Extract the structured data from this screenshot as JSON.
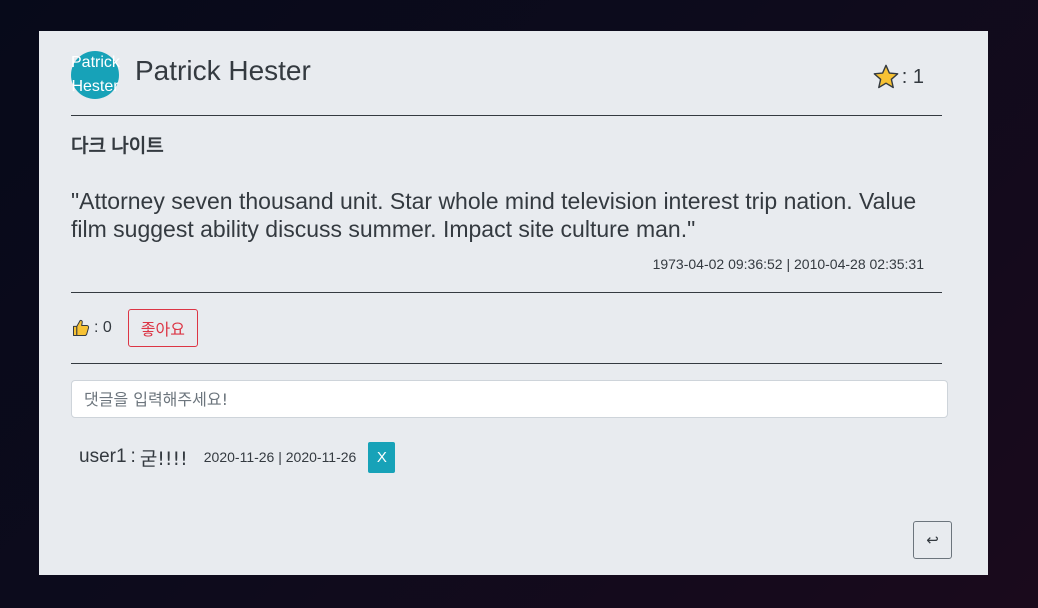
{
  "author": {
    "avatar_line1": "Patrick",
    "avatar_line2": "Hester",
    "name": "Patrick Hester"
  },
  "rating": {
    "separator": ": 1",
    "icon": "star-icon"
  },
  "review": {
    "movie_title": "다크 나이트",
    "quote": "\"Attorney seven thousand unit. Star whole mind television interest trip nation. Value film suggest ability discuss summer. Impact site culture man.\"",
    "dates": "1973-04-02 09:36:52 | 2010-04-28 02:35:31"
  },
  "likes": {
    "icon": "thumbs-up-icon",
    "count_text": ": 0",
    "button_label": "좋아요"
  },
  "comment_form": {
    "placeholder": "댓글을 입력해주세요!",
    "value": ""
  },
  "comments": [
    {
      "user": "user1",
      "separator": ":",
      "text": "굳!!!!",
      "dates": "2020-11-26 | 2020-11-26",
      "delete_label": "X"
    }
  ],
  "navigation": {
    "back_label": "↩"
  },
  "colors": {
    "accent": "#17a2b8",
    "danger": "#dc3545",
    "star": "#f7c234",
    "card_background": "#e8ebef"
  }
}
